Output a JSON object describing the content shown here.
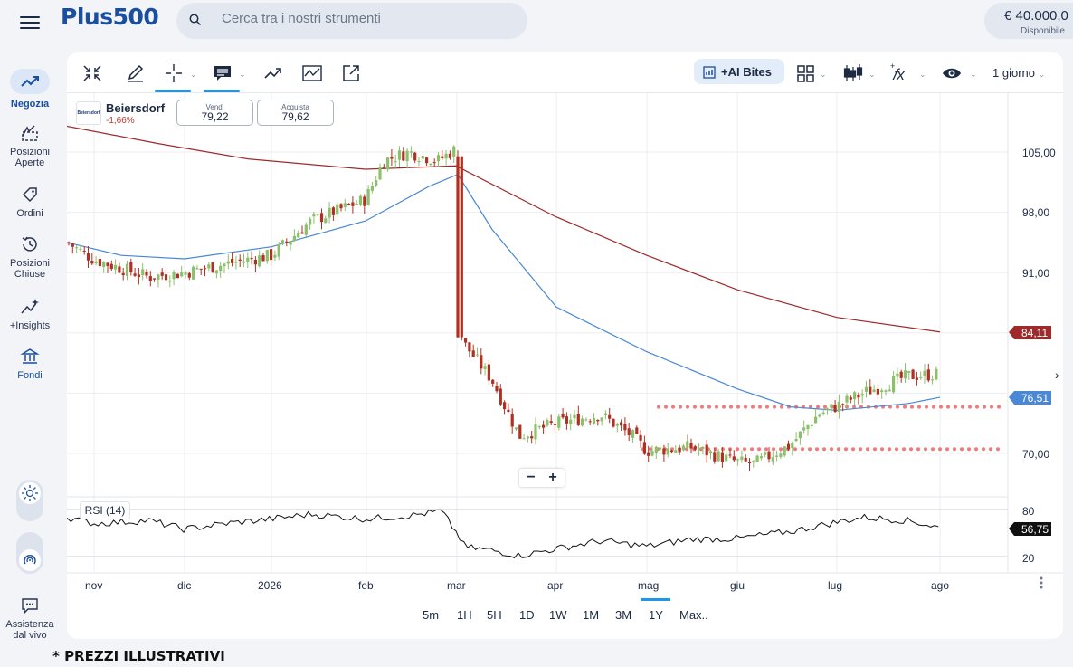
{
  "brand": {
    "logo_text": "Plus500"
  },
  "search": {
    "placeholder": "Cerca tra i nostri strumenti"
  },
  "balance": {
    "amount": "€ 40.000,0",
    "label": "Disponibile"
  },
  "sidebar": {
    "items": [
      {
        "label": "Negozia",
        "icon": "trend-up-icon"
      },
      {
        "label": "Posizioni Aperte",
        "icon": "open-positions-icon"
      },
      {
        "label": "Ordini",
        "icon": "tag-icon"
      },
      {
        "label": "Posizioni Chiuse",
        "icon": "history-icon"
      },
      {
        "label": "+Insights",
        "icon": "sparkle-chart-icon"
      },
      {
        "label": "Fondi",
        "icon": "bank-icon"
      }
    ],
    "support_label": "Assistenza dal vivo"
  },
  "toolbar": {
    "ai_bites": "+AI Bites",
    "interval": "1 giorno"
  },
  "instrument": {
    "logo_text": "Beiersdorf",
    "name": "Beiersdorf",
    "change": "-1,66%",
    "sell_label": "Vendi",
    "sell_price": "79,22",
    "buy_label": "Acquista",
    "buy_price": "79,62"
  },
  "chart": {
    "price_ticks": [
      "105,00",
      "98,00",
      "91,00",
      "70,00"
    ],
    "ma_long_badge": "84,11",
    "ma_short_badge": "76,51",
    "month_labels": [
      "nov",
      "dic",
      "2026",
      "feb",
      "mar",
      "apr",
      "mag",
      "giu",
      "lug",
      "ago"
    ],
    "rsi_label": "RSI (14)",
    "rsi_ticks": [
      "80",
      "20"
    ],
    "rsi_badge": "56,75",
    "zoom_out": "−",
    "zoom_in": "+"
  },
  "chart_data": {
    "type": "candlestick",
    "instrument": "Beiersdorf",
    "interval": "1 giorno",
    "y_axis_ticks": [
      105,
      98,
      91,
      70
    ],
    "x_axis_ticks": [
      "nov",
      "dic",
      "2026",
      "feb",
      "mar",
      "apr",
      "mag",
      "giu",
      "lug",
      "ago"
    ],
    "close_path": [
      {
        "x": "nov",
        "y": 92.5
      },
      {
        "x": "dic",
        "y": 91.0
      },
      {
        "x": "2026",
        "y": 93.0
      },
      {
        "x": "gen-mid",
        "y": 97.5
      },
      {
        "x": "feb",
        "y": 103.5
      },
      {
        "x": "feb-end",
        "y": 105.0
      },
      {
        "x": "mar",
        "y": 82.5
      },
      {
        "x": "apr",
        "y": 73.5
      },
      {
        "x": "mag",
        "y": 70.5
      },
      {
        "x": "giu",
        "y": 69.0
      },
      {
        "x": "lug",
        "y": 75.5
      },
      {
        "x": "ago",
        "y": 79.2
      }
    ],
    "moving_average_long": {
      "last_value": 84.11,
      "color": "#9e2a2b"
    },
    "moving_average_short": {
      "last_value": 76.51,
      "color": "#4a88d4"
    },
    "support_levels": [
      70.5,
      75.4
    ],
    "rsi": {
      "period": 14,
      "last_value": 56.75,
      "levels": [
        80,
        20
      ]
    }
  },
  "timeframes": [
    "5m",
    "1H",
    "5H",
    "1D",
    "1W",
    "1M",
    "3M",
    "1Y",
    "Max.."
  ],
  "disclaimer": "* PREZZI ILLUSTRATIVI",
  "colors": {
    "brand": "#1a4fa0",
    "accent": "#2196e8",
    "candle_up": "#8cc06a",
    "candle_down": "#b03022",
    "support_dots": "#f07a7a"
  }
}
